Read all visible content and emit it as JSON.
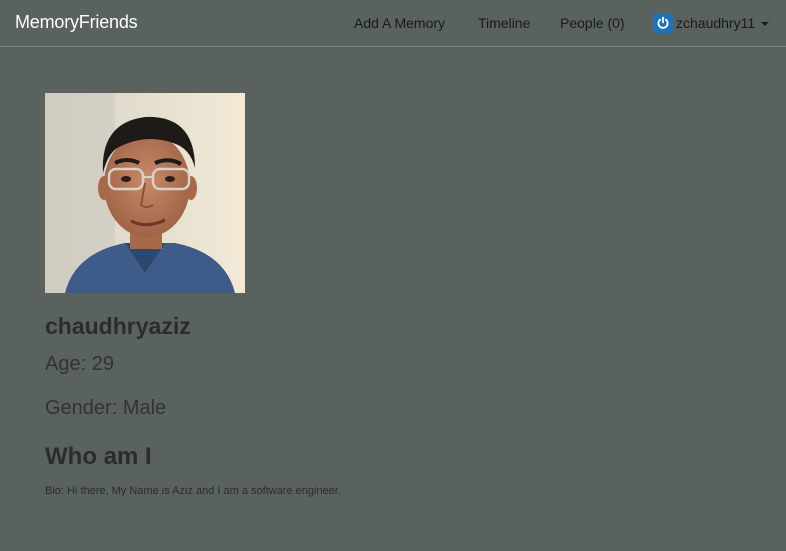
{
  "navbar": {
    "brand": "MemoryFriends",
    "links": {
      "add_memory": "Add A Memory",
      "timeline": "Timeline",
      "people": "People (0)"
    },
    "user": {
      "username": "zchaudhry11",
      "icon": "power-icon"
    }
  },
  "profile": {
    "photo_icon": "profile-photo",
    "username": "chaudhryaziz",
    "age": "Age: 29",
    "gender": "Gender: Male",
    "about_heading": "Who am I",
    "bio": "Bio: Hi there, My Name is Aziz and I am a software engineer."
  },
  "colors": {
    "background": "#59625e",
    "brand_text": "#ffffff",
    "user_icon": "#1d72b8"
  }
}
